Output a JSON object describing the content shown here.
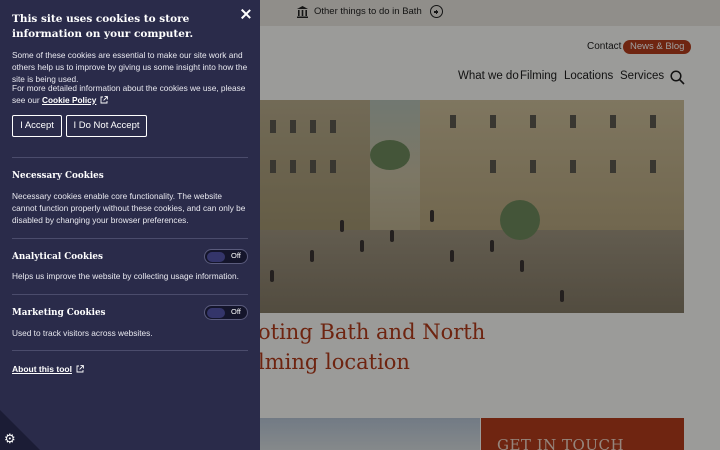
{
  "topbar": {
    "link_label": "Other things to do in Bath"
  },
  "header": {
    "contact_label": "Contact",
    "news_label": "News & Blog",
    "nav": [
      "What we do",
      "Filming",
      "Locations",
      "Services"
    ]
  },
  "hero": {
    "alt": ""
  },
  "headline": {
    "line1": "oting Bath and North",
    "line2": "lming location"
  },
  "get_in_touch": {
    "label": "GET IN TOUCH"
  },
  "cookie_panel": {
    "title": "This site uses cookies to store information on your computer.",
    "intro": "Some of these cookies are essential to make our site work and others help us to improve by giving us some insight into how the site is being used.",
    "more_info_text": "For more detailed information about the cookies we use, please see our Cookie Policy.",
    "policy_link": "Cookie Policy",
    "accept_label": "I Accept",
    "reject_label": "I Do Not Accept",
    "sections": [
      {
        "title": "Necessary Cookies",
        "text": "Necessary cookies enable core functionality. The website cannot function properly without these cookies, and can only be disabled by changing your browser preferences."
      },
      {
        "title": "Analytical Cookies",
        "text": "Helps us improve the website by collecting usage information.",
        "toggle": "Off"
      },
      {
        "title": "Marketing Cookies",
        "text": "Used to track visitors across websites.",
        "toggle": "Off"
      }
    ],
    "about_label": "About this tool"
  },
  "colors": {
    "panel": "#2a2b4a",
    "accent": "#b33d1c"
  },
  "icons": [
    "building-icon",
    "plus-circle-icon",
    "search-icon",
    "close-icon",
    "external-link-icon",
    "gear-icon"
  ]
}
